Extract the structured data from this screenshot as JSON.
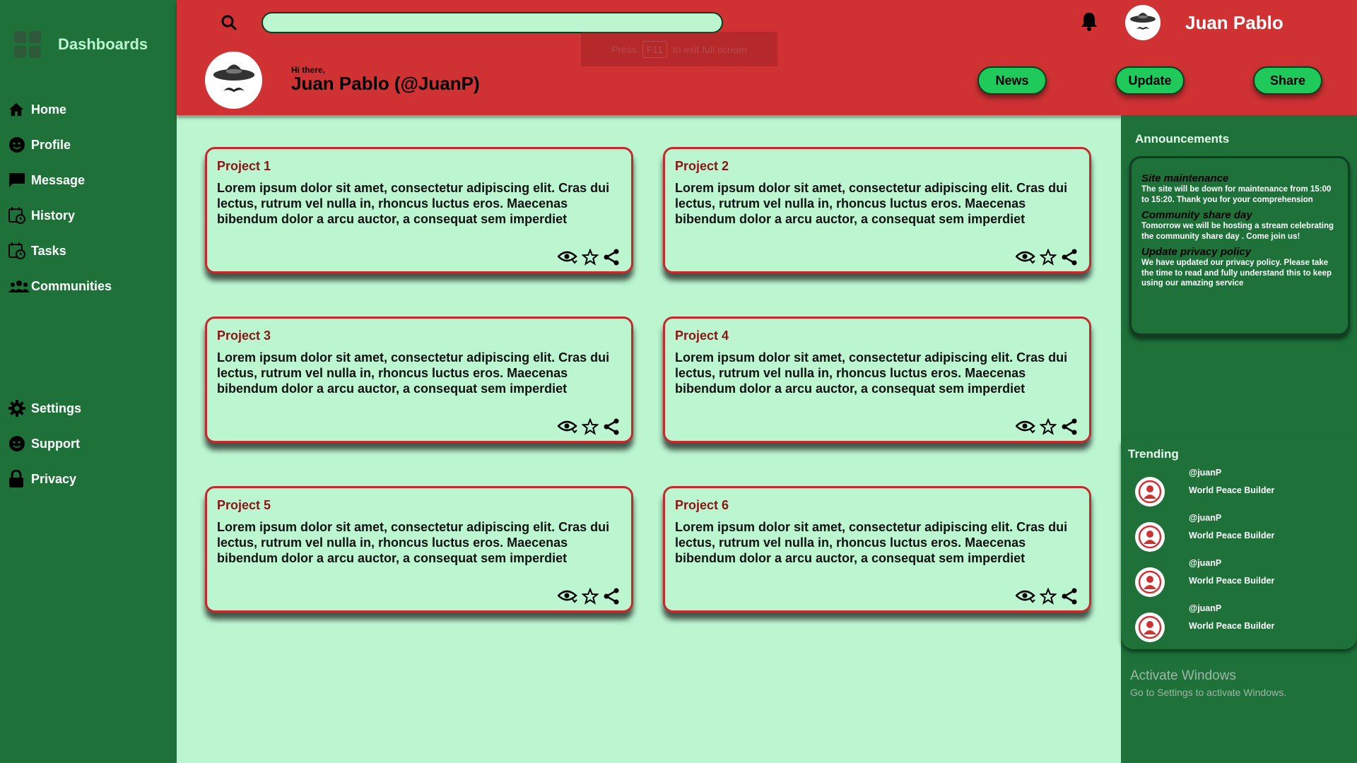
{
  "sidebar": {
    "brand": "Dashboards",
    "items": [
      {
        "label": "Home",
        "icon": "home-icon"
      },
      {
        "label": "Profile",
        "icon": "profile-icon"
      },
      {
        "label": "Message",
        "icon": "message-icon"
      },
      {
        "label": "History",
        "icon": "history-icon"
      },
      {
        "label": "Tasks",
        "icon": "tasks-icon"
      },
      {
        "label": "Communities",
        "icon": "communities-icon"
      }
    ],
    "bottom_items": [
      {
        "label": "Settings",
        "icon": "gear-icon"
      },
      {
        "label": "Support",
        "icon": "support-icon"
      },
      {
        "label": "Privacy",
        "icon": "lock-icon"
      }
    ]
  },
  "header": {
    "search_placeholder": "",
    "fullscreen_hint": {
      "pre": "Press",
      "key": "F11",
      "post": "to exit full screen"
    },
    "top_user_name": "Juan Pablo",
    "greeting": "Hi there,",
    "user_handle": "Juan Pablo (@JuanP)",
    "buttons": [
      "News",
      "Update",
      "Share"
    ]
  },
  "projects": [
    {
      "title": "Project 1",
      "body": "Lorem ipsum dolor sit amet, consectetur adipiscing elit. Cras dui lectus, rutrum vel nulla in, rhoncus luctus eros. Maecenas bibendum dolor a arcu auctor, a consequat sem imperdiet"
    },
    {
      "title": "Project 2",
      "body": "Lorem ipsum dolor sit amet, consectetur adipiscing elit. Cras dui lectus, rutrum vel nulla in, rhoncus luctus eros. Maecenas bibendum dolor a arcu auctor, a consequat sem imperdiet"
    },
    {
      "title": "Project 3",
      "body": "Lorem ipsum dolor sit amet, consectetur adipiscing elit. Cras dui lectus, rutrum vel nulla in, rhoncus luctus eros. Maecenas bibendum dolor a arcu auctor, a consequat sem imperdiet"
    },
    {
      "title": "Project 4",
      "body": "Lorem ipsum dolor sit amet, consectetur adipiscing elit. Cras dui lectus, rutrum vel nulla in, rhoncus luctus eros. Maecenas bibendum dolor a arcu auctor, a consequat sem imperdiet"
    },
    {
      "title": "Project 5",
      "body": "Lorem ipsum dolor sit amet, consectetur adipiscing elit. Cras dui lectus, rutrum vel nulla in, rhoncus luctus eros. Maecenas bibendum dolor a arcu auctor, a consequat sem imperdiet"
    },
    {
      "title": "Project 6",
      "body": "Lorem ipsum dolor sit amet, consectetur adipiscing elit. Cras dui lectus, rutrum vel nulla in, rhoncus luctus eros. Maecenas bibendum dolor a arcu auctor, a consequat sem imperdiet"
    }
  ],
  "announcements": {
    "title": "Announcements",
    "items": [
      {
        "title": "Site maintenance",
        "text": "The site will be down for maintenance from 15:00 to 15:20. Thank you for your comprehension"
      },
      {
        "title": "Community share day",
        "text": "Tomorrow we will be hosting a stream celebrating the community share day . Come join us!"
      },
      {
        "title": "Update privacy policy",
        "text": "We have updated our privacy policy. Please take the time to read and fully understand this to keep using our amazing service"
      }
    ]
  },
  "trending": {
    "title": "Trending",
    "items": [
      {
        "handle": "@juanP",
        "subtitle": "World Peace Builder"
      },
      {
        "handle": "@juanP",
        "subtitle": "World Peace Builder"
      },
      {
        "handle": "@juanP",
        "subtitle": "World Peace Builder"
      },
      {
        "handle": "@juanP",
        "subtitle": "World Peace Builder"
      }
    ]
  },
  "watermark": {
    "title": "Activate Windows",
    "subtitle": "Go to Settings to activate Windows."
  },
  "colors": {
    "sidebar_bg": "#1d7139",
    "header_bg": "#d03234",
    "main_bg": "#bbf6d1",
    "button_green": "#1fc95a",
    "card_border": "#c42a2c",
    "card_title": "#8b1414"
  }
}
